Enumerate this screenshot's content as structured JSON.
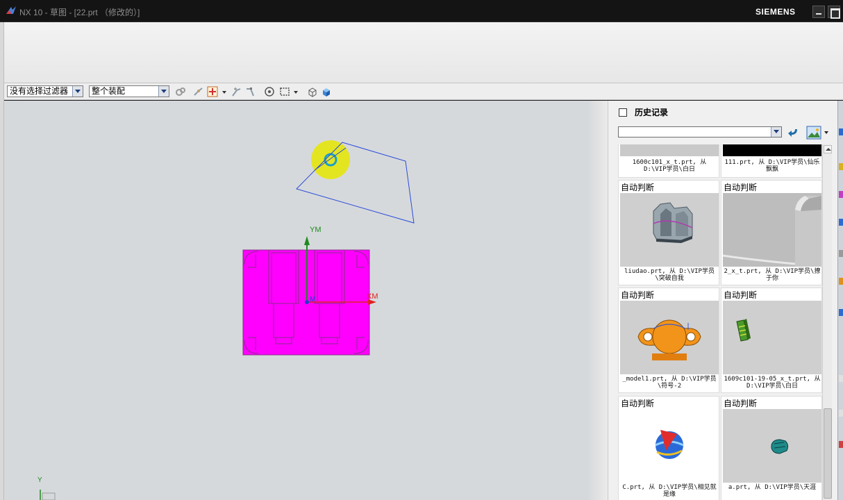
{
  "window": {
    "title": "NX 10 - 草图 - [22.prt （修改的）]",
    "brand": "SIEMENS"
  },
  "toolbar": {
    "filter_value": "没有选择过滤器",
    "scope_value": "整个装配"
  },
  "viewport": {
    "axis_ym": "YM",
    "axis_xm": "XM",
    "axis_zm": "M",
    "triad_y": "Y",
    "part_color": "#ff00ff",
    "highlight_color": "#e6e600",
    "sketch_color": "#2a4bd8"
  },
  "history": {
    "title": "历史记录",
    "items": [
      {
        "label": "",
        "caption": "1600c101_x_t.prt, 从 D:\\VIP学员\\白日"
      },
      {
        "label": "",
        "caption": "111.prt, 从 D:\\VIP学员\\仙乐飘飘"
      },
      {
        "label": "自动判断",
        "caption": "liudao.prt, 从 D:\\VIP学员\\突破自我"
      },
      {
        "label": "自动判断",
        "caption": "2_x_t.prt, 从 D:\\VIP学员\\撩于你"
      },
      {
        "label": "自动判断",
        "caption": "_model1.prt, 从 D:\\VIP学员\\符号-2"
      },
      {
        "label": "自动判断",
        "caption": "1609c101-19-05_x_t.prt, 从 D:\\VIP学员\\白日"
      },
      {
        "label": "自动判断",
        "caption": "C.prt, 从 D:\\VIP学员\\相见就是缘"
      },
      {
        "label": "自动判断",
        "caption": "a.prt, 从 D:\\VIP学员\\天涯"
      }
    ]
  }
}
